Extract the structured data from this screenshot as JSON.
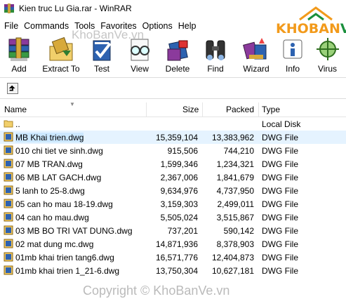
{
  "window": {
    "title": "Kien truc Lu Gia.rar - WinRAR"
  },
  "logo": {
    "text_main": "KHOBAN",
    "text_accent": "VE"
  },
  "watermarks": {
    "top": "KhoBanVe.vn",
    "bottom": "Copyright © KhoBanVe.vn"
  },
  "menu": [
    "File",
    "Commands",
    "Tools",
    "Favorites",
    "Options",
    "Help"
  ],
  "toolbar": [
    {
      "label": "Add",
      "icon": "add-books-icon"
    },
    {
      "label": "Extract To",
      "icon": "extract-folder-icon"
    },
    {
      "label": "Test",
      "icon": "test-check-icon"
    },
    {
      "label": "View",
      "icon": "view-glasses-icon"
    },
    {
      "label": "Delete",
      "icon": "delete-icon"
    },
    {
      "label": "Find",
      "icon": "find-binoculars-icon"
    },
    {
      "label": "Wizard",
      "icon": "wizard-icon"
    },
    {
      "label": "Info",
      "icon": "info-icon"
    },
    {
      "label": "Virus",
      "icon": "virus-scan-icon"
    }
  ],
  "columns": {
    "name": "Name",
    "size": "Size",
    "packed": "Packed",
    "type": "Type"
  },
  "files": [
    {
      "name": "..",
      "size": "",
      "packed": "",
      "type": "Local Disk",
      "icon": "parent-folder-icon"
    },
    {
      "name": "MB Khai trien.dwg",
      "size": "15,359,104",
      "packed": "13,383,962",
      "type": "DWG File",
      "icon": "dwg-file-icon"
    },
    {
      "name": "010 chi tiet ve sinh.dwg",
      "size": "915,506",
      "packed": "744,210",
      "type": "DWG File",
      "icon": "dwg-file-icon"
    },
    {
      "name": "07 MB TRAN.dwg",
      "size": "1,599,346",
      "packed": "1,234,321",
      "type": "DWG File",
      "icon": "dwg-file-icon"
    },
    {
      "name": "06 MB LAT GACH.dwg",
      "size": "2,367,006",
      "packed": "1,841,679",
      "type": "DWG File",
      "icon": "dwg-file-icon"
    },
    {
      "name": "5 lanh to 25-8.dwg",
      "size": "9,634,976",
      "packed": "4,737,950",
      "type": "DWG File",
      "icon": "dwg-file-icon"
    },
    {
      "name": "05 can ho mau 18-19.dwg",
      "size": "3,159,303",
      "packed": "2,499,011",
      "type": "DWG File",
      "icon": "dwg-file-icon"
    },
    {
      "name": "04 can ho mau.dwg",
      "size": "5,505,024",
      "packed": "3,515,867",
      "type": "DWG File",
      "icon": "dwg-file-icon"
    },
    {
      "name": "03 MB BO TRI VAT DUNG.dwg",
      "size": "737,201",
      "packed": "590,142",
      "type": "DWG File",
      "icon": "dwg-file-icon"
    },
    {
      "name": "02 mat dung mc.dwg",
      "size": "14,871,936",
      "packed": "8,378,903",
      "type": "DWG File",
      "icon": "dwg-file-icon"
    },
    {
      "name": "01mb khai trien tang6.dwg",
      "size": "16,571,776",
      "packed": "12,404,873",
      "type": "DWG File",
      "icon": "dwg-file-icon"
    },
    {
      "name": "01mb khai trien 1_21-6.dwg",
      "size": "13,750,304",
      "packed": "10,627,181",
      "type": "DWG File",
      "icon": "dwg-file-icon"
    }
  ],
  "colors": {
    "selection": "#cce8ff",
    "logo_orange": "#f29a1b",
    "logo_green": "#1a8f3c"
  }
}
